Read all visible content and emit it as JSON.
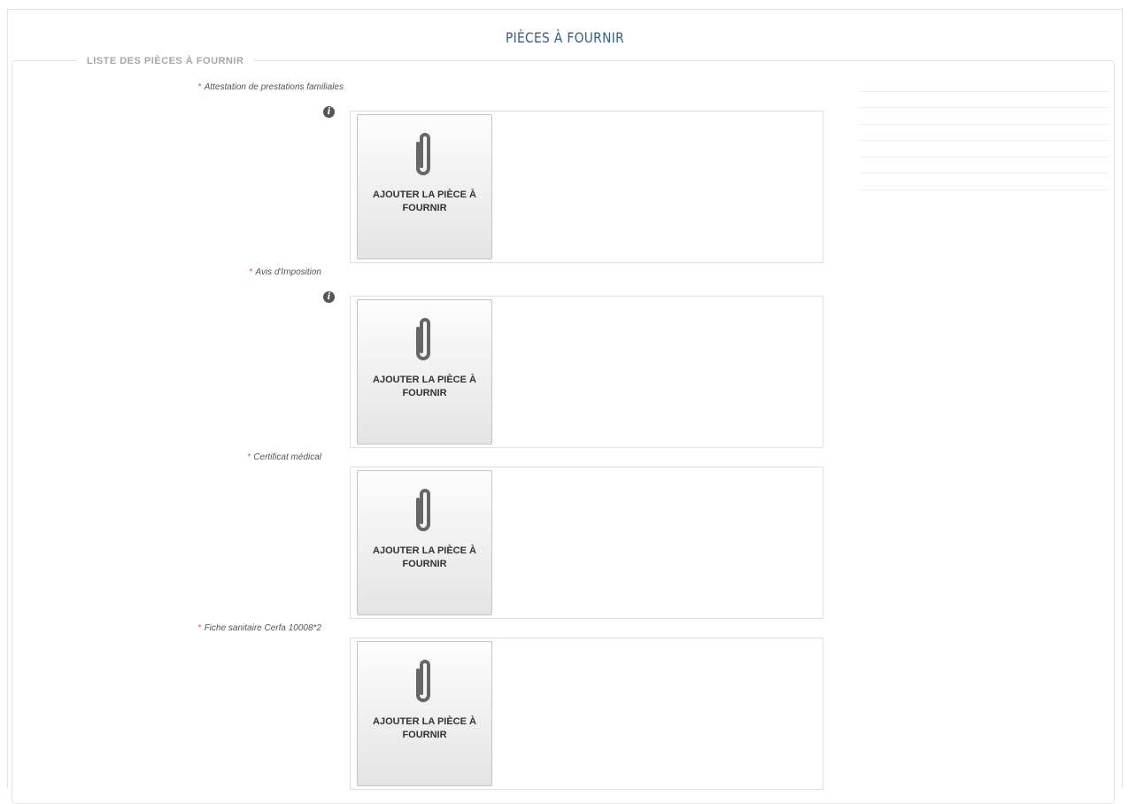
{
  "page_title": "PIÈCES À FOURNIR",
  "section_legend": "LISTE DES PIÈCES À FOURNIR",
  "required_marker": "*",
  "upload_button_label": "AJOUTER LA PIÈCE À FOURNIR",
  "colors": {
    "title": "#2f5f8c",
    "required": "#d9534f",
    "legend": "#a7a7a7"
  },
  "documents": [
    {
      "label": "Attestation de prestations familiales",
      "has_info": true
    },
    {
      "label": "Avis d'Imposition",
      "has_info": true
    },
    {
      "label": "Certificat médical",
      "has_info": false
    },
    {
      "label": "Fiche sanitaire Cerfa 10008*2",
      "has_info": false
    }
  ],
  "icons": {
    "info": "info-circle-icon",
    "upload": "paperclip-icon"
  }
}
